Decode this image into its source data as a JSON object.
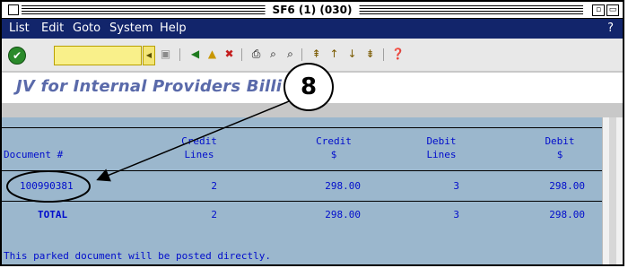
{
  "window": {
    "title": "SF6 (1) (030)"
  },
  "menu": {
    "items": [
      "List",
      "Edit",
      "Goto",
      "System",
      "Help"
    ],
    "help_glyph": "?"
  },
  "toolbar": {
    "command_value": "",
    "icons": [
      "check-icon",
      "back-icon",
      "exit-icon",
      "cancel-icon",
      "print-icon",
      "find-icon",
      "find-next-icon",
      "first-page-icon",
      "previous-page-icon",
      "next-page-icon",
      "last-page-icon",
      "help-icon"
    ]
  },
  "page": {
    "title": "JV for Internal Providers Billi"
  },
  "table": {
    "headers": {
      "document": "Document #",
      "credit_lines_1": "Credit",
      "credit_lines_2": "Lines",
      "credit_amt_1": "Credit",
      "credit_amt_2": "$",
      "debit_lines_1": "Debit",
      "debit_lines_2": "Lines",
      "debit_amt_1": "Debit",
      "debit_amt_2": "$"
    },
    "rows": [
      {
        "document": "100990381",
        "credit_lines": "2",
        "credit_amount": "298.00",
        "debit_lines": "3",
        "debit_amount": "298.00"
      }
    ],
    "total": {
      "label": "TOTAL",
      "credit_lines": "2",
      "credit_amount": "298.00",
      "debit_lines": "3",
      "debit_amount": "298.00"
    },
    "message": "This parked document will be posted directly."
  },
  "annotation": {
    "number": "8"
  },
  "colors": {
    "menubar": "#12256b",
    "content_bg": "#9bb7cd",
    "table_text": "#000ccc",
    "title_text": "#5a6aaa"
  }
}
